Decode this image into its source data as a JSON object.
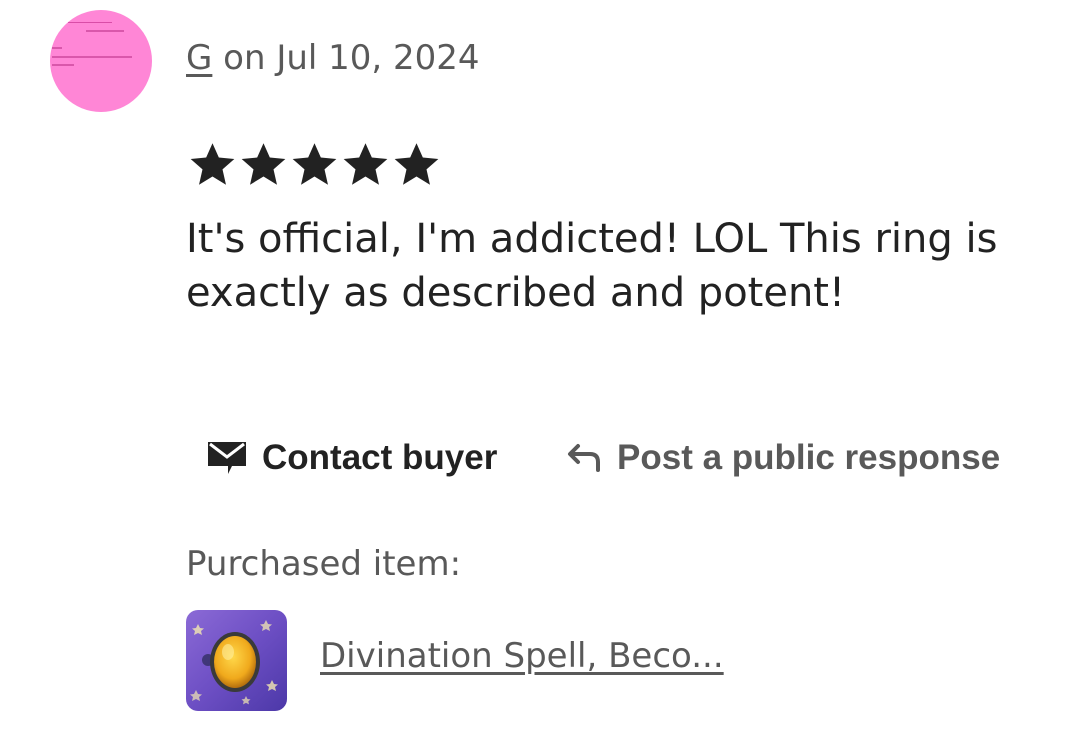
{
  "review": {
    "reviewer_name": "G",
    "date_prefix": " on ",
    "date": "Jul 10, 2024",
    "rating_out_of_5": 5,
    "text": "It's official, I'm addicted! LOL This ring is exactly as described and potent!"
  },
  "actions": {
    "contact_label": "Contact buyer",
    "respond_label": "Post a public response"
  },
  "purchased": {
    "label": "Purchased item:",
    "item_title": "Divination Spell, Beco..."
  },
  "icons": {
    "contact": "envelope-icon",
    "respond": "reply-arrow-icon",
    "rating": "star-icon"
  },
  "colors": {
    "primary_text": "#222222",
    "secondary_text": "#595959",
    "avatar_bg": "#ff86d6"
  }
}
